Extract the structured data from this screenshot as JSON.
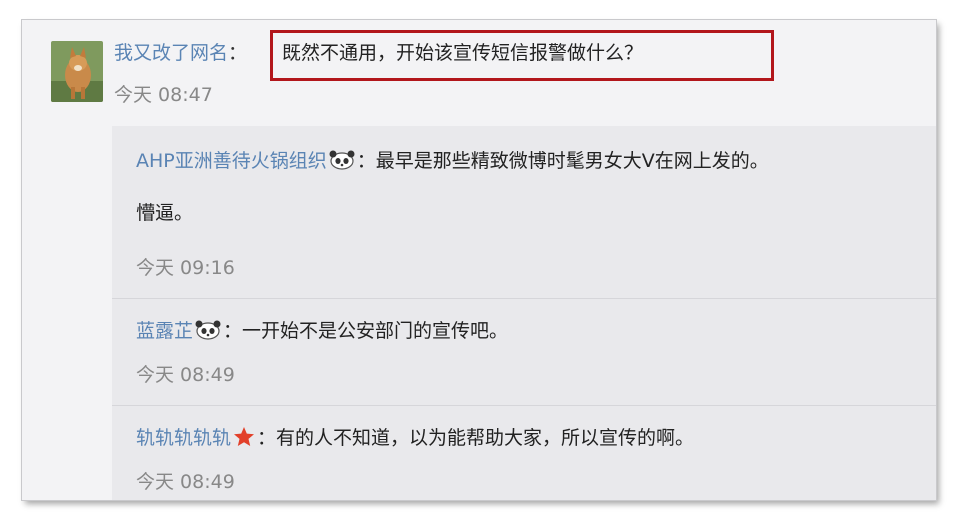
{
  "main_comment": {
    "username": "我又改了网名",
    "separator": "：",
    "text": "既然不通用，开始该宣传短信报警做什么？",
    "time": "今天 08:47",
    "avatar_icon": "fox-avatar-icon",
    "highlight_color": "#b2161b"
  },
  "replies": [
    {
      "username": "AHP亚洲善待火锅组织",
      "badge_icon": "panda-icon",
      "separator": "：",
      "text_line1": "最早是那些精致微博时髦男女大V在网上发的。",
      "text_line2": "懵逼。",
      "time": "今天 09:16"
    },
    {
      "username": "蓝露芷",
      "badge_icon": "panda-icon",
      "separator": "：",
      "text_line1": "一开始不是公安部门的宣传吧。",
      "time": "今天 08:49"
    },
    {
      "username": "轨轨轨轨轨",
      "badge_icon": "star-icon",
      "separator": "：",
      "text_line1": "有的人不知道，以为能帮助大家，所以宣传的啊。",
      "time": "今天 08:49"
    }
  ],
  "colors": {
    "username": "#5a84b4",
    "text": "#222222",
    "time": "#888888",
    "background": "#f3f3f5",
    "reply_background": "#e9e9ec",
    "star": "#e2402a"
  }
}
